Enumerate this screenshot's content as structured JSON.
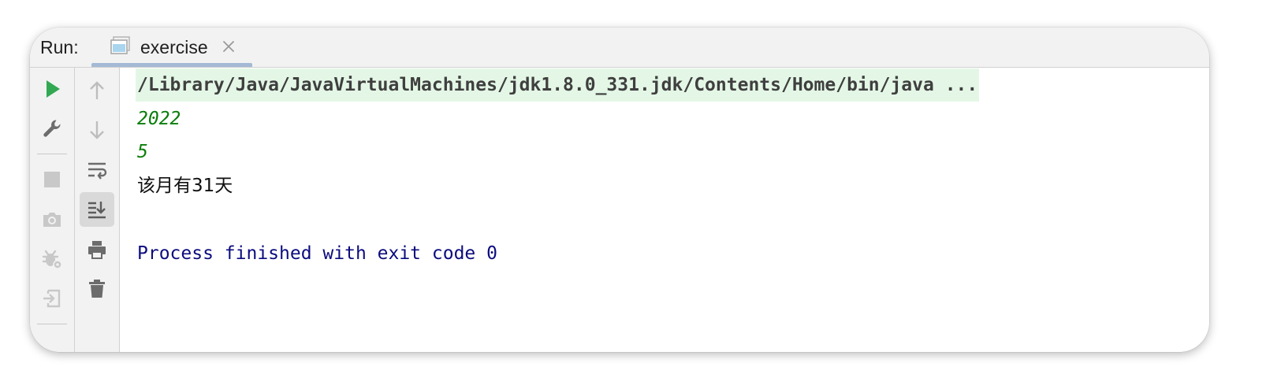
{
  "run_panel": {
    "label": "Run:",
    "tab": {
      "title": "exercise",
      "icon": "console-window-icon",
      "close_icon": "close-icon"
    }
  },
  "toolbar_left": [
    {
      "name": "rerun-icon",
      "color": "#33a853"
    },
    {
      "name": "wrench-icon"
    },
    {
      "name": "stop-icon",
      "enabled": false
    },
    {
      "name": "camera-icon",
      "enabled": false
    },
    {
      "name": "debug-settings-icon",
      "enabled": false
    },
    {
      "name": "exit-icon",
      "enabled": false
    }
  ],
  "toolbar_right": [
    {
      "name": "arrow-up-icon",
      "enabled": false
    },
    {
      "name": "arrow-down-icon",
      "enabled": false
    },
    {
      "name": "soft-wrap-icon"
    },
    {
      "name": "scroll-to-end-icon",
      "active": true
    },
    {
      "name": "print-icon"
    },
    {
      "name": "trash-icon"
    }
  ],
  "console": {
    "command": "/Library/Java/JavaVirtualMachines/jdk1.8.0_331.jdk/Contents/Home/bin/java ...",
    "input_lines": [
      "2022",
      "5"
    ],
    "output": "该月有31天",
    "exit_message": "Process finished with exit code 0"
  },
  "colors": {
    "command_bg": "#e4f7e6",
    "input_text": "#0a7d0a",
    "exit_text": "#0c0c7e",
    "run_green": "#33a853"
  }
}
